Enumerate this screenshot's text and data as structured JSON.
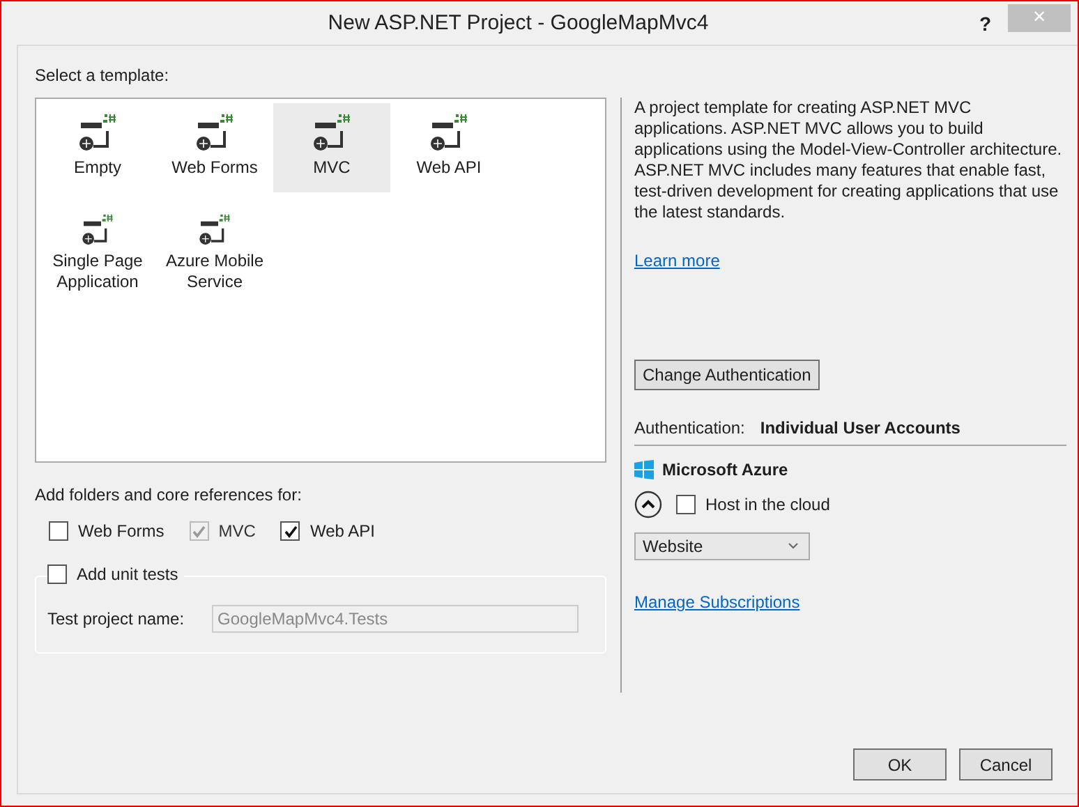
{
  "window": {
    "title": "New ASP.NET Project - GoogleMapMvc4",
    "help": "?",
    "close": "×"
  },
  "templates": {
    "label": "Select a template:",
    "items": [
      {
        "label": "Empty",
        "selected": false
      },
      {
        "label": "Web Forms",
        "selected": false
      },
      {
        "label": "MVC",
        "selected": true
      },
      {
        "label": "Web API",
        "selected": false
      },
      {
        "label": "Single Page Application",
        "selected": false
      },
      {
        "label": "Azure Mobile Service",
        "selected": false
      }
    ]
  },
  "references": {
    "label": "Add folders and core references for:",
    "options": [
      {
        "label": "Web Forms",
        "checked": false,
        "disabled": false
      },
      {
        "label": "MVC",
        "checked": true,
        "disabled": true
      },
      {
        "label": "Web API",
        "checked": true,
        "disabled": false
      }
    ]
  },
  "unit_tests": {
    "label": "Add unit tests",
    "checked": false,
    "name_label": "Test project name:",
    "name_value": "GoogleMapMvc4.Tests"
  },
  "description": "A project template for creating ASP.NET MVC applications. ASP.NET MVC allows you to build applications using the Model-View-Controller architecture. ASP.NET MVC includes many features that enable fast, test-driven development for creating applications that use the latest standards.",
  "learn_more": "Learn more",
  "change_auth": "Change Authentication",
  "authentication": {
    "label": "Authentication:",
    "value": "Individual User Accounts"
  },
  "azure": {
    "title": "Microsoft Azure",
    "expanded": true,
    "host_label": "Host in the cloud",
    "host_checked": false,
    "type": "Website",
    "manage": "Manage Subscriptions"
  },
  "buttons": [
    "OK",
    "Cancel"
  ]
}
